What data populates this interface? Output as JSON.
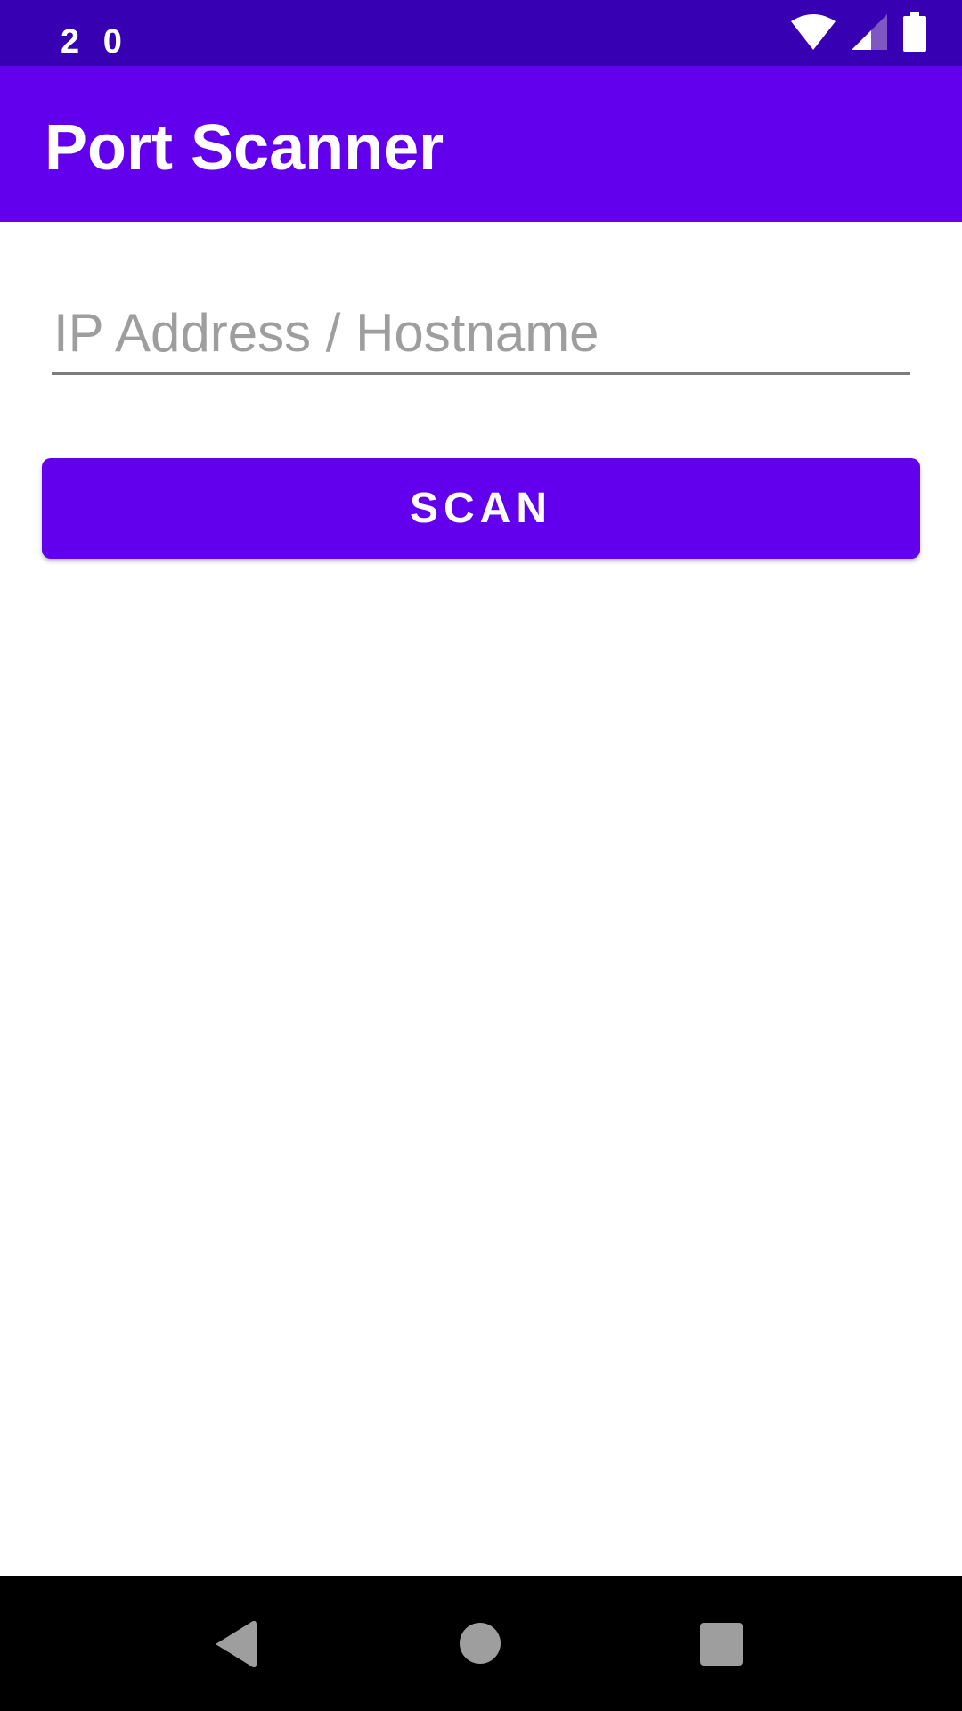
{
  "status_bar": {
    "time": "2 0",
    "icons": [
      "wifi-icon",
      "cell-signal-icon",
      "battery-icon"
    ],
    "background_color": "#3700b3"
  },
  "app_bar": {
    "title": "Port Scanner",
    "background_color": "#6200ee"
  },
  "form": {
    "ip_input": {
      "value": "",
      "placeholder": "IP Address / Hostname"
    },
    "scan_button": {
      "label": "SCAN",
      "background_color": "#6200ee"
    }
  },
  "nav_bar": {
    "icons": [
      "back-icon",
      "home-icon",
      "recents-icon"
    ]
  }
}
